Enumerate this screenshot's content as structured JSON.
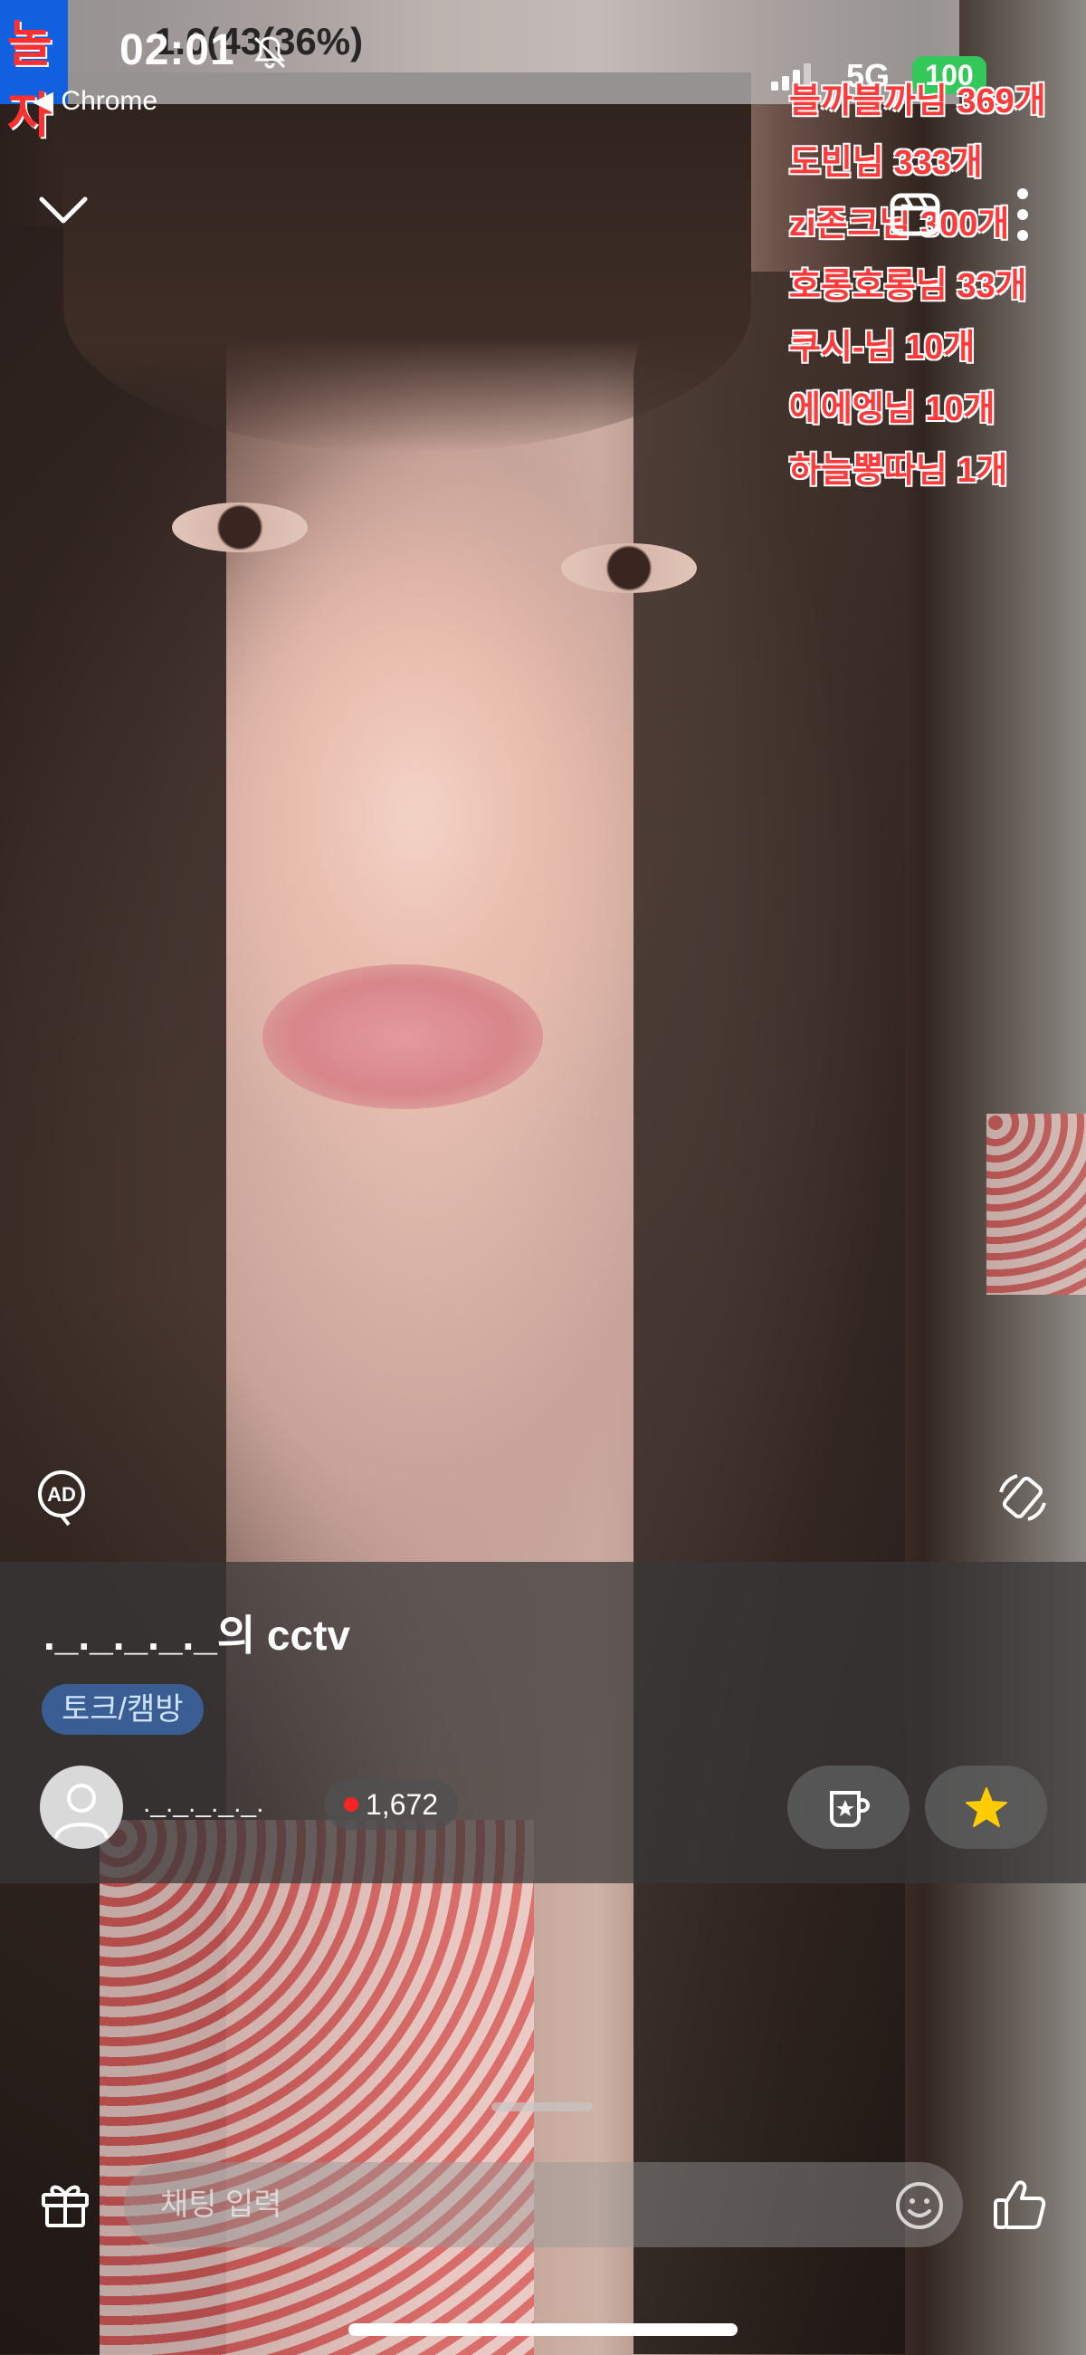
{
  "status_bar": {
    "logo": "놀자",
    "time": "02:01",
    "battery_overlay": "1.0(43(36%)",
    "back_app": "◀ Chrome",
    "network": "5G",
    "battery": "100"
  },
  "ranking": [
    "블까블까님 369개",
    "도빈님 333개",
    "zi존크님 300개",
    "호롱호롱님 33개",
    "쿠시-님 10개",
    "에에엥님 10개",
    "하늘뽕따님 1개"
  ],
  "stream": {
    "title": "._._._._._의 cctv",
    "category": "토크/캠방",
    "streamer": "._._._._._.",
    "viewers": "1,672"
  },
  "chat": {
    "placeholder": "채팅 입력"
  },
  "icons": {
    "collapse": "chevron-down-icon",
    "clip": "clapperboard-icon",
    "more": "more-vertical-icon",
    "ad": "ad-icon",
    "rotate": "rotate-screen-icon",
    "gift": "gift-icon",
    "emoji": "emoji-icon",
    "like": "thumbs-up-icon",
    "subscribe": "cup-star-icon",
    "favorite": "star-icon"
  },
  "colors": {
    "ranking_text": "#ff3a3a",
    "favorite_star": "#ffcc00",
    "battery": "#34c759",
    "live_dot": "#ff2222"
  }
}
